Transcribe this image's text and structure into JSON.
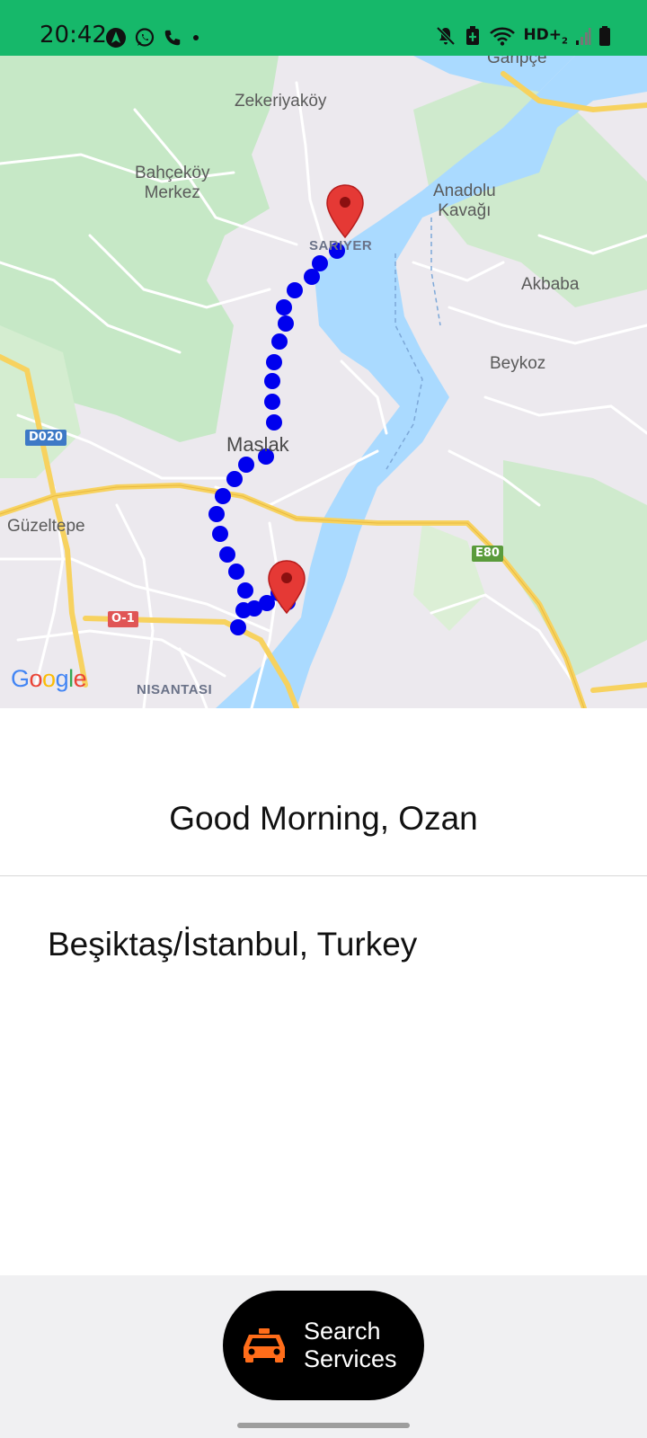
{
  "status_bar": {
    "time": "20:42",
    "network": "HD+",
    "network_sub": "2",
    "left_icons": [
      "nav-app-icon",
      "whatsapp-icon",
      "phone-icon",
      "dot-icon"
    ],
    "right_icons": [
      "mute-icon",
      "battery-saver-icon",
      "wifi-icon",
      "signal-icon",
      "battery-icon"
    ]
  },
  "map": {
    "labels": {
      "garipce": "Garipçe",
      "zekeriyakoy": "Zekeriyaköy",
      "bahcekoy": "Bahçeköy\nMerkez",
      "anadolu": "Anadolu\nKavağı",
      "sariyer": "SARIYER",
      "akbaba": "Akbaba",
      "beykoz": "Beykoz",
      "maslak": "Maslak",
      "guzeltepe": "Güzeltepe",
      "nisantasi": "NISANTASI"
    },
    "shields": {
      "d020": "D020",
      "e80": "E80",
      "o1": "O-1"
    },
    "colors": {
      "water": "#aadaff",
      "park": "#c6e8c6",
      "land": "#ece9ee",
      "road": "#ffffff",
      "highway": "#f7d25f",
      "route": "#0000ee",
      "pin": "#e53935"
    },
    "attribution": [
      "G",
      "o",
      "o",
      "g",
      "l",
      "e"
    ]
  },
  "greeting": "Good Morning, Ozan",
  "location": "Beşiktaş/İstanbul, Turkey",
  "search_button": {
    "label": "Search\nServices",
    "icon": "taxi-icon",
    "icon_color": "#ff6d1a"
  }
}
